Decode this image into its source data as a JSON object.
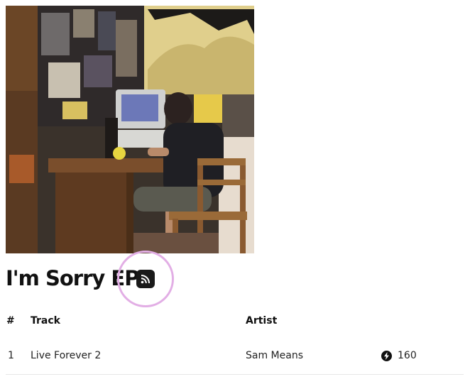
{
  "album": {
    "title": "I'm Sorry EP",
    "cover": {
      "description_icon": "album-cover-photo"
    },
    "rss_icon": "rss-feed-icon"
  },
  "table": {
    "headers": {
      "number": "#",
      "track": "Track",
      "artist": "Artist"
    },
    "rows": [
      {
        "number": "1",
        "track": "Live Forever 2",
        "artist": "Sam Means",
        "plays_icon": "lightning-bolt-icon",
        "plays": "160"
      }
    ]
  },
  "colors": {
    "highlight_ring": "#e2aee5",
    "icon_bg": "#1a1a1a",
    "divider": "#e6e6e6"
  }
}
